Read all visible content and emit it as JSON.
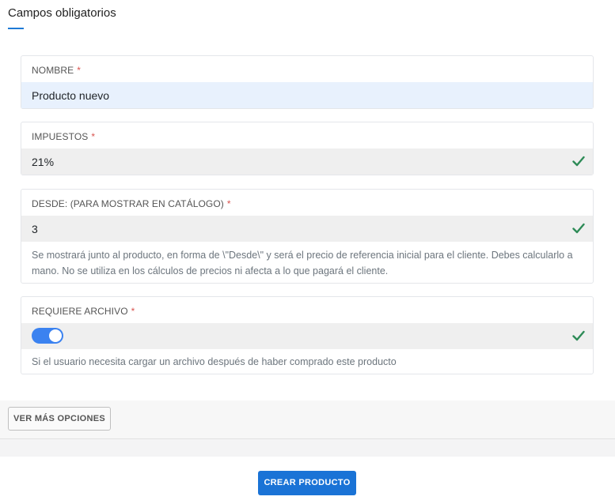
{
  "section": {
    "title": "Campos obligatorios",
    "accent_color": "#1e7ad6"
  },
  "fields": {
    "nombre": {
      "label": "NOMBRE",
      "required_mark": "*",
      "value": "Producto nuevo"
    },
    "impuestos": {
      "label": "IMPUESTOS",
      "required_mark": "*",
      "value": "21%",
      "valid_icon": "check-icon"
    },
    "desde": {
      "label": "DESDE: (PARA MOSTRAR EN CATÁLOGO)",
      "required_mark": "*",
      "value": "3",
      "valid_icon": "check-icon",
      "help": "Se mostrará junto al producto, en forma de \\\"Desde\\\" y será el precio de referencia inicial para el cliente. Debes calcularlo a mano. No se utiliza en los cálculos de precios ni afecta a lo que pagará el cliente."
    },
    "requiere_archivo": {
      "label": "REQUIERE ARCHIVO",
      "required_mark": "*",
      "toggle_on": true,
      "valid_icon": "check-icon",
      "help": "Si el usuario necesita cargar un archivo después de haber comprado este producto"
    }
  },
  "buttons": {
    "more_options": "VER MÁS OPCIONES",
    "create": "CREAR PRODUCTO"
  },
  "colors": {
    "primary": "#1a73d6",
    "toggle": "#3b82f0",
    "valid": "#2e8b57",
    "required": "#d9534f"
  }
}
